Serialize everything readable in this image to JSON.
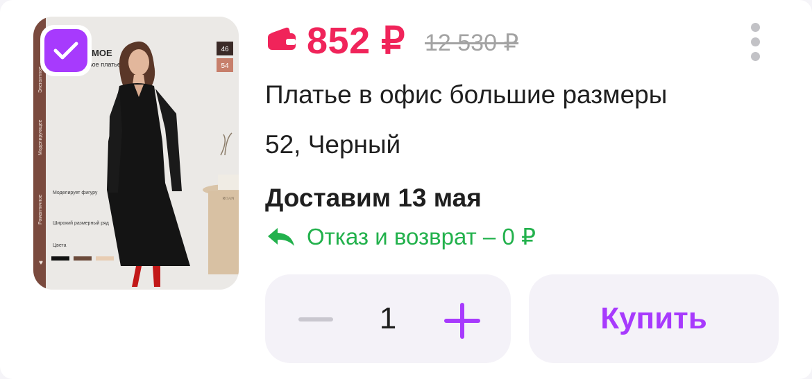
{
  "product": {
    "image_alt": "product-photo",
    "image_text": {
      "heading": "МОЕ",
      "subheading": "вое платье",
      "size_1": "46",
      "size_2": "54",
      "side_tags": [
        "Элегантное",
        "Моделирующее",
        "Романтичное"
      ],
      "features": [
        "Моделирует фигуру",
        "Широкий размерный ряд",
        "Цвета"
      ],
      "lamp_label": "ROAN"
    },
    "selected": true,
    "price": "852 ₽",
    "old_price": "12 530 ₽",
    "title": "Платье в офис большие размеры",
    "variant": "52, Черный",
    "delivery": "Доставим 13 мая",
    "return_policy": "Отказ и возврат – 0 ₽"
  },
  "controls": {
    "quantity": "1",
    "buy_label": "Купить"
  },
  "colors": {
    "accent": "#a73afd",
    "price": "#f0245a",
    "return": "#22b14c"
  }
}
